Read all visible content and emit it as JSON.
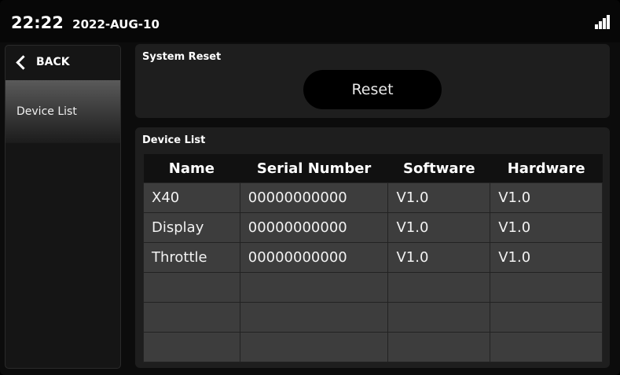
{
  "statusbar": {
    "time": "22:22",
    "date": "2022-AUG-10",
    "signal_icon": "signal-bars-icon"
  },
  "sidebar": {
    "back_label": "BACK",
    "items": [
      {
        "label": "Device List",
        "selected": true
      }
    ]
  },
  "system_reset": {
    "title": "System Reset",
    "button_label": "Reset"
  },
  "device_list": {
    "title": "Device List",
    "columns": [
      "Name",
      "Serial Number",
      "Software",
      "Hardware"
    ],
    "rows": [
      [
        "X40",
        "00000000000",
        "V1.0",
        "V1.0"
      ],
      [
        "Display",
        "00000000000",
        "V1.0",
        "V1.0"
      ],
      [
        "Throttle",
        "00000000000",
        "V1.0",
        "V1.0"
      ],
      [
        "",
        "",
        "",
        ""
      ],
      [
        "",
        "",
        "",
        ""
      ],
      [
        "",
        "",
        "",
        ""
      ]
    ]
  }
}
